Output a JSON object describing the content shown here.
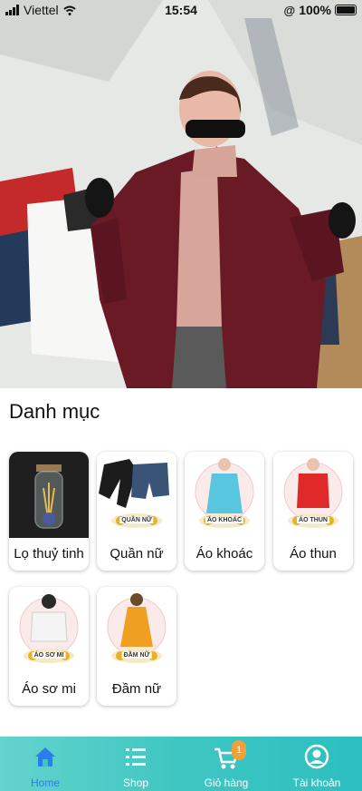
{
  "status_bar": {
    "carrier": "Viettel",
    "time": "15:54",
    "battery": "100%"
  },
  "banner": {
    "image": "woman-with-shopping-bags-photo"
  },
  "category_section": {
    "title": "Danh mục",
    "items": [
      {
        "label": "Lọ thuỷ tinh",
        "tag": ""
      },
      {
        "label": "Quần nữ",
        "tag": "QUẦN NỮ"
      },
      {
        "label": "Áo khoác",
        "tag": "ÁO KHOÁC"
      },
      {
        "label": "Áo thun",
        "tag": "ÁO THUN"
      },
      {
        "label": "Áo sơ mi",
        "tag": "ÁO SƠ MI"
      },
      {
        "label": "Đầm nữ",
        "tag": "ĐẦM NỮ"
      }
    ]
  },
  "tab_bar": {
    "tabs": [
      {
        "label": "Home",
        "icon": "home-icon",
        "active": true
      },
      {
        "label": "Shop",
        "icon": "list-icon"
      },
      {
        "label": "Giỏ hàng",
        "icon": "cart-icon",
        "badge": "1"
      },
      {
        "label": "Tài khoản",
        "icon": "user-icon"
      }
    ],
    "colors": {
      "active": "#2b7de9",
      "bar": "#3fc6c2",
      "badge": "#f3a03a"
    }
  }
}
